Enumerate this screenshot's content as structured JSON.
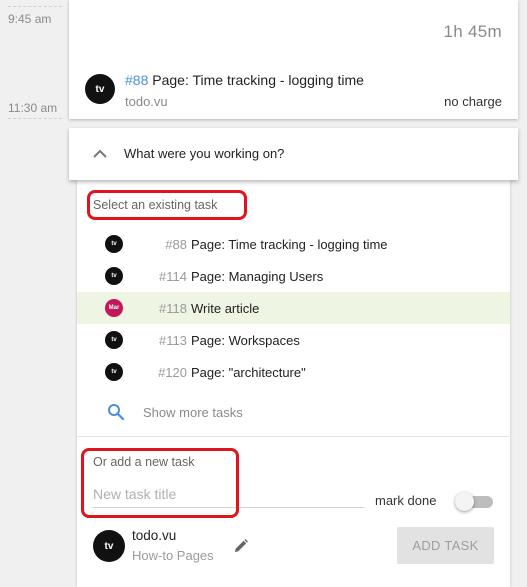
{
  "timeline": {
    "label_top": "9:45 am",
    "label_bottom": "11:30 am"
  },
  "entry": {
    "duration": "1h 45m",
    "task_number": "#88",
    "task_title": "Page: Time tracking - logging time",
    "project": "todo.vu",
    "charge": "no charge",
    "avatar_text": "tv"
  },
  "question": {
    "label": "What were you working on?",
    "icon": "chevron-up-icon"
  },
  "picker": {
    "existing_label": "Select an existing task",
    "tasks": [
      {
        "avatar": "tv",
        "number": "#88",
        "name": "Page: Time tracking - logging time",
        "active": false
      },
      {
        "avatar": "tv",
        "number": "#114",
        "name": "Page: Managing Users",
        "active": false
      },
      {
        "avatar": "Mar",
        "number": "#118",
        "name": "Write article",
        "active": true
      },
      {
        "avatar": "tv",
        "number": "#113",
        "name": "Page: Workspaces",
        "active": false
      },
      {
        "avatar": "tv",
        "number": "#120",
        "name": "Page: \"architecture\"",
        "active": false
      }
    ],
    "show_more": "Show more tasks",
    "new_label": "Or add a new task",
    "new_placeholder": "New task title",
    "mark_done_label": "mark done",
    "mark_done_on": false,
    "project_name": "todo.vu",
    "project_list": "How-to Pages",
    "project_avatar": "tv",
    "add_button": "ADD TASK"
  },
  "colors": {
    "highlight": "#e0141e",
    "active_row": "#eef5e3",
    "link_blue": "#4a90d6",
    "mar_avatar": "#c2185b"
  }
}
